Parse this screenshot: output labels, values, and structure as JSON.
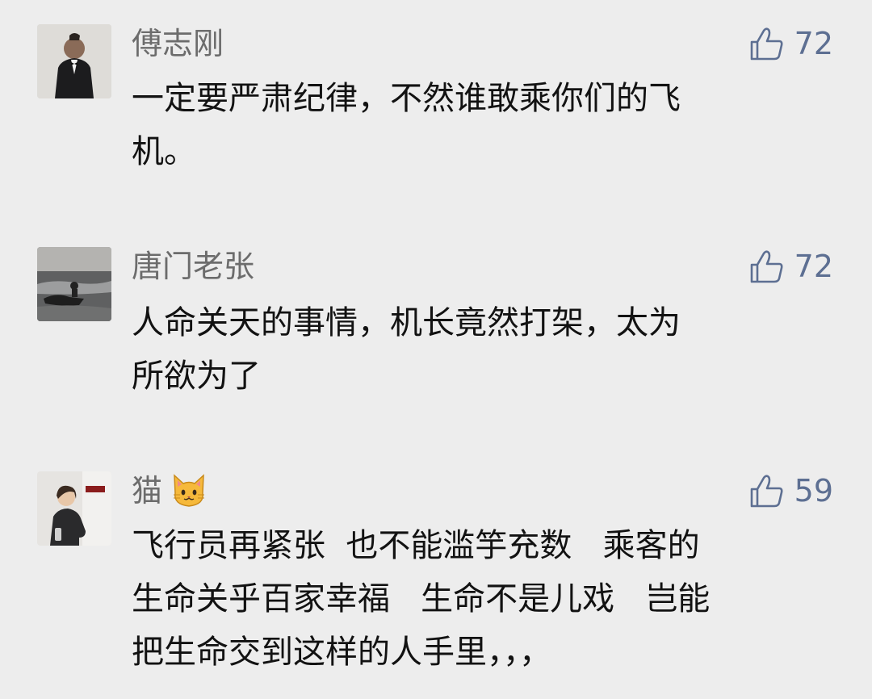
{
  "comments": [
    {
      "name": "傅志刚",
      "likes": "72",
      "lines": [
        "一定要严肃纪律，不然谁敢乘你们的飞",
        "机。"
      ],
      "avatar": "person-in-tuxedo"
    },
    {
      "name": "唐门老张",
      "likes": "72",
      "lines": [
        "人命关天的事情，机长竟然打架，太为",
        "所欲为了"
      ],
      "avatar": "jet-ski-on-sea"
    },
    {
      "name": "猫",
      "name_emoji": "cat-face",
      "likes": "59",
      "lines": [
        "飞行员再紧张  也不能滥竽充数   乘客的",
        "生命关乎百家幸福   生命不是儿戏   岂能",
        "把生命交到这样的人手里，，，"
      ],
      "avatar": "seated-person"
    }
  ],
  "icons": {
    "like": "thumbs-up-icon"
  },
  "colors": {
    "background": "#ededed",
    "name": "#6c6c6c",
    "like": "#5d6f92",
    "text": "#121212"
  }
}
